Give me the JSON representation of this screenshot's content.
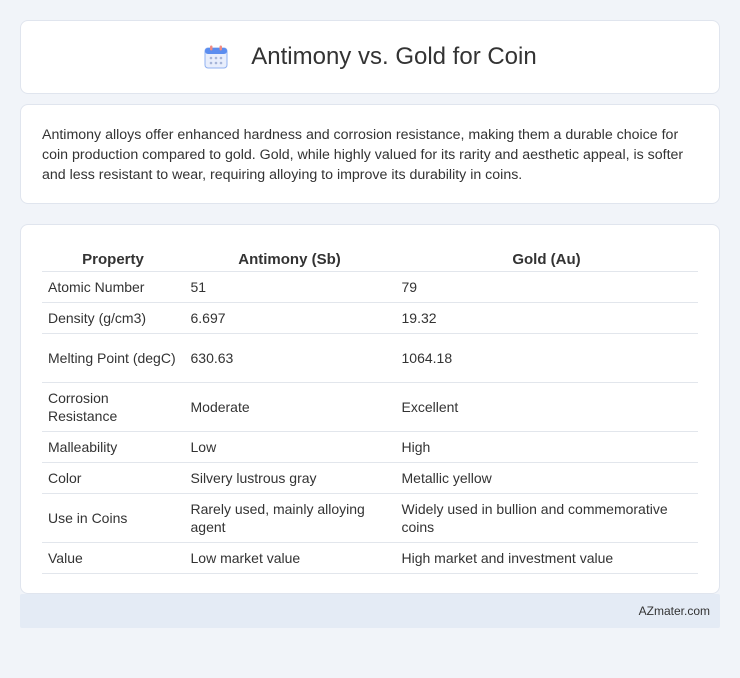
{
  "header": {
    "title": "Antimony vs. Gold for Coin",
    "icon": "calendar-icon",
    "icon_color": "#5b8def",
    "icon_accent": "#f28b82"
  },
  "summary": {
    "text": "Antimony alloys offer enhanced hardness and corrosion resistance, making them a durable choice for coin production compared to gold. Gold, while highly valued for its rarity and aesthetic appeal, is softer and less resistant to wear, requiring alloying to improve its durability in coins."
  },
  "table": {
    "headers": [
      "Property",
      "Antimony (Sb)",
      "Gold (Au)"
    ],
    "rows": [
      [
        "Atomic Number",
        "51",
        "79"
      ],
      [
        "Density (g/cm3)",
        "6.697",
        "19.32"
      ],
      [
        "Melting Point (degC)",
        "630.63",
        "1064.18"
      ],
      [
        "Corrosion Resistance",
        "Moderate",
        "Excellent"
      ],
      [
        "Malleability",
        "Low",
        "High"
      ],
      [
        "Color",
        "Silvery lustrous gray",
        "Metallic yellow"
      ],
      [
        "Use in Coins",
        "Rarely used, mainly alloying agent",
        "Widely used in bullion and commemorative coins"
      ],
      [
        "Value",
        "Low market value",
        "High market and investment value"
      ]
    ]
  },
  "footer": {
    "brand": "AZmater.com"
  }
}
